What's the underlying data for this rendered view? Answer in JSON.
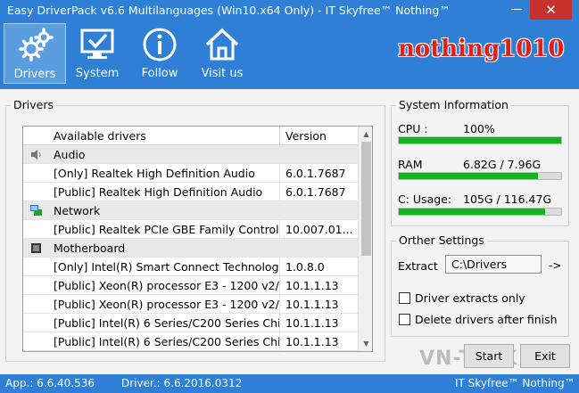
{
  "window": {
    "title": "Easy DriverPack v6.6 Multilanguages (Win10.x64 Only) - IT Skyfree™  Nothing™",
    "minimize": "—",
    "close": "✕"
  },
  "toolbar": {
    "drivers": "Drivers",
    "system": "System",
    "follow": "Follow",
    "visit": "Visit us",
    "brand": "nothing1010"
  },
  "drivers_panel": {
    "title": "Drivers",
    "columns": {
      "name": "Available drivers",
      "version": "Version"
    },
    "rows": [
      {
        "type": "category",
        "label": "Audio",
        "icon": "speaker-icon"
      },
      {
        "type": "item",
        "name": "[Only] Realtek High Definition Audio",
        "version": "6.0.1.7687"
      },
      {
        "type": "item",
        "name": "[Public] Realtek High Definition Audio",
        "version": "6.0.1.7687"
      },
      {
        "type": "category",
        "label": "Network",
        "icon": "network-icon"
      },
      {
        "type": "item",
        "name": "[Public] Realtek PCIe GBE Family Controll...",
        "version": "10.007.01..."
      },
      {
        "type": "category",
        "label": "Motherboard",
        "icon": "chip-icon"
      },
      {
        "type": "item",
        "name": "[Only] Intel(R) Smart Connect Technology...",
        "version": "1.0.8.0"
      },
      {
        "type": "item",
        "name": "[Public] Xeon(R) processor E3 - 1200 v2/...",
        "version": "10.1.1.13"
      },
      {
        "type": "item",
        "name": "[Public] Xeon(R) processor E3 - 1200 v2/...",
        "version": "10.1.1.13"
      },
      {
        "type": "item",
        "name": "[Public] Intel(R) 6 Series/C200 Series Chi...",
        "version": "10.1.1.13"
      },
      {
        "type": "item",
        "name": "[Public] Intel(R) 6 Series/C200 Series Chi...",
        "version": "10.1.1.13"
      }
    ]
  },
  "system_info": {
    "title": "System Information",
    "cpu": {
      "label": "CPU :",
      "value": "100%",
      "fraction": 1.0
    },
    "ram": {
      "label": "RAM",
      "value": "6.82G / 7.96G",
      "fraction": 0.857
    },
    "disk": {
      "label": "C: Usage:",
      "value": "105G / 116.47G",
      "fraction": 0.9
    },
    "bar_color": "#16b025"
  },
  "other_settings": {
    "title": "Orther Settings",
    "extract_label": "Extract",
    "extract_value": "C:\\Drivers",
    "extract_arrow": "->",
    "option1": "Driver extracts only",
    "option2": "Delete drivers after finish"
  },
  "buttons": {
    "start": "Start",
    "exit": "Exit"
  },
  "statusbar": {
    "app": "App.: 6.6.40.536",
    "driver": "Driver.: 6.6.2016.0312",
    "credit": "IT Skyfree™  Nothing™"
  },
  "watermark": "VN-TEEK",
  "colors": {
    "accent": "#2f7fd6",
    "close": "#c9302c",
    "brand": "#e0201b"
  }
}
